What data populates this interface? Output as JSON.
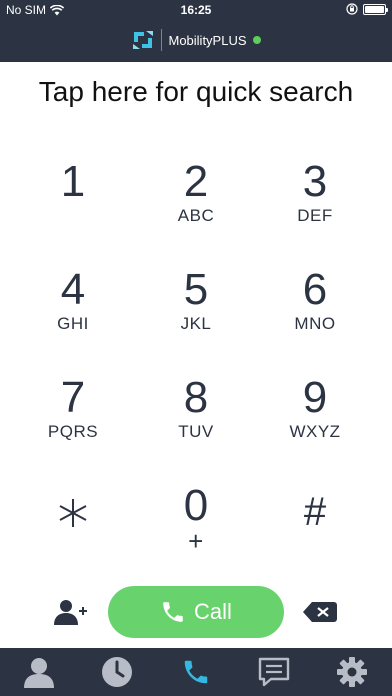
{
  "status_bar": {
    "carrier": "No SIM",
    "time": "16:25",
    "icons": [
      "wifi-icon",
      "rotation-lock-icon",
      "battery-icon"
    ]
  },
  "header": {
    "app_name": "MobilityPLUS",
    "presence_color": "#5cce5c",
    "logo_color": "#3ec3e6"
  },
  "search": {
    "placeholder": "Tap here for quick search"
  },
  "keypad": {
    "keys": [
      {
        "digit": "1",
        "letters": ""
      },
      {
        "digit": "2",
        "letters": "ABC"
      },
      {
        "digit": "3",
        "letters": "DEF"
      },
      {
        "digit": "4",
        "letters": "GHI"
      },
      {
        "digit": "5",
        "letters": "JKL"
      },
      {
        "digit": "6",
        "letters": "MNO"
      },
      {
        "digit": "7",
        "letters": "PQRS"
      },
      {
        "digit": "8",
        "letters": "TUV"
      },
      {
        "digit": "9",
        "letters": "WXYZ"
      },
      {
        "digit": "*",
        "letters": ""
      },
      {
        "digit": "0",
        "letters": "+"
      },
      {
        "digit": "#",
        "letters": ""
      }
    ]
  },
  "actions": {
    "call_label": "Call",
    "call_color": "#68d36c",
    "icons": [
      "add-contact-icon",
      "phone-icon",
      "backspace-icon"
    ]
  },
  "tabbar": {
    "background": "#2c3443",
    "inactive_color": "#b7bcc6",
    "active_color": "#35b8df",
    "active_tab": "dialpad",
    "tabs": [
      "contacts-icon",
      "recents-icon",
      "dialpad-phone-icon",
      "chat-icon",
      "settings-gear-icon"
    ]
  }
}
